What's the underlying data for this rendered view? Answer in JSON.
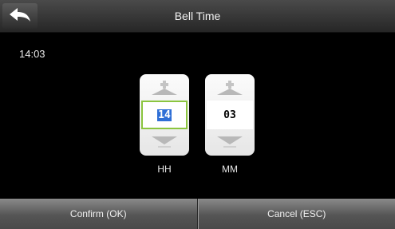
{
  "header": {
    "title": "Bell Time",
    "back_icon": "back-arrow-icon"
  },
  "current_time": "14:03",
  "spinners": {
    "hh": {
      "value": "14",
      "label": "HH",
      "focused": true
    },
    "mm": {
      "value": "03",
      "label": "MM",
      "focused": false
    }
  },
  "icons": {
    "increment": "plus-arrow-up-icon",
    "decrement": "arrow-down-icon"
  },
  "footer": {
    "confirm_label": "Confirm (OK)",
    "cancel_label": "Cancel (ESC)"
  },
  "colors": {
    "focus_border": "#8bc53f",
    "selection": "#2f6fd6",
    "arrow": "#b8b8b8"
  }
}
